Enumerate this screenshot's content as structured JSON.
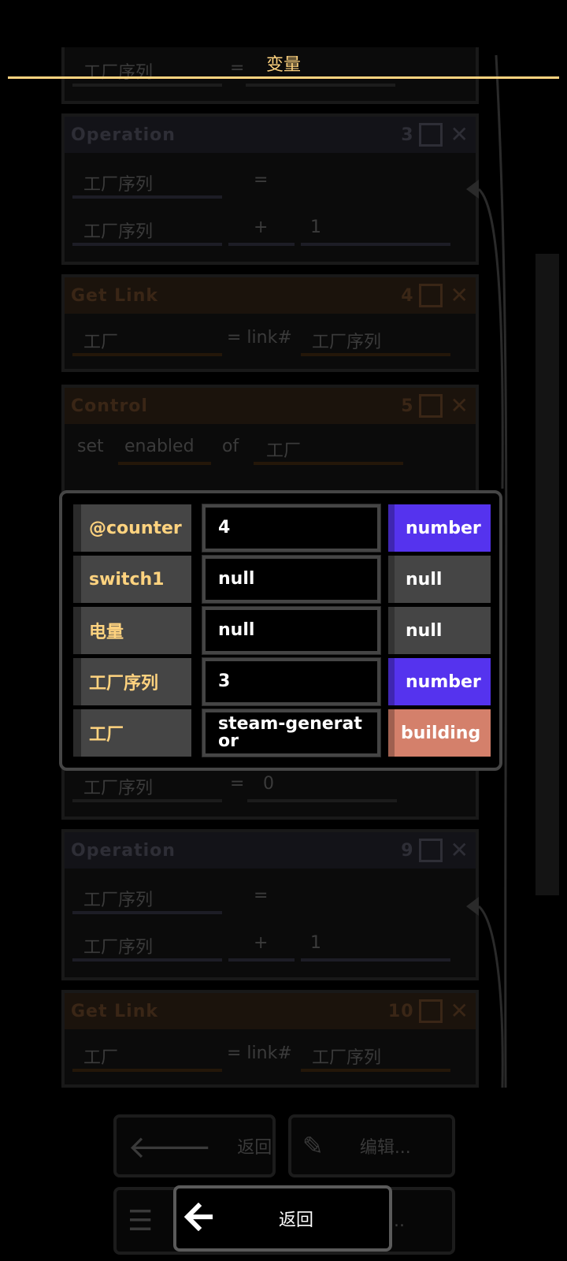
{
  "title": "变量",
  "background_blocks": [
    {
      "head": "",
      "left_var": "工厂序列",
      "op": "=",
      "right": ""
    },
    {
      "head": "Operation",
      "index": "3",
      "row1_var": "工厂序列",
      "row1_op": "=",
      "row2_var": "工厂序列",
      "row2_op": "+",
      "row2_val": "1"
    },
    {
      "head": "Get Link",
      "index": "4",
      "left": "工厂",
      "op": "= link#",
      "right": "工厂序列"
    },
    {
      "head": "Control",
      "index": "5",
      "set": "set",
      "prop": "enabled",
      "of": "of",
      "target": "工厂"
    },
    {
      "left_var": "工厂序列",
      "op": "=",
      "right": "0"
    },
    {
      "head": "Operation",
      "index": "9",
      "row1_var": "工厂序列",
      "row1_op": "=",
      "row2_var": "工厂序列",
      "row2_op": "+",
      "row2_val": "1"
    },
    {
      "head": "Get Link",
      "index": "10",
      "left": "工厂",
      "op": "= link#",
      "right": "工厂序列"
    }
  ],
  "background_buttons": {
    "back": "返回",
    "edit": "编辑...",
    "more": "..."
  },
  "variables": [
    {
      "name": "@counter",
      "value": "4",
      "type": "number",
      "type_color": "#5533ee"
    },
    {
      "name": "switch1",
      "value": "null",
      "type": "null",
      "type_color": "#454545"
    },
    {
      "name": "电量",
      "value": "null",
      "type": "null",
      "type_color": "#454545"
    },
    {
      "name": "工厂序列",
      "value": "3",
      "type": "number",
      "type_color": "#5533ee"
    },
    {
      "name": "工厂",
      "value": "steam-generator",
      "type": "building",
      "type_color": "#d4806b"
    }
  ],
  "back_button": {
    "label": "返回"
  }
}
